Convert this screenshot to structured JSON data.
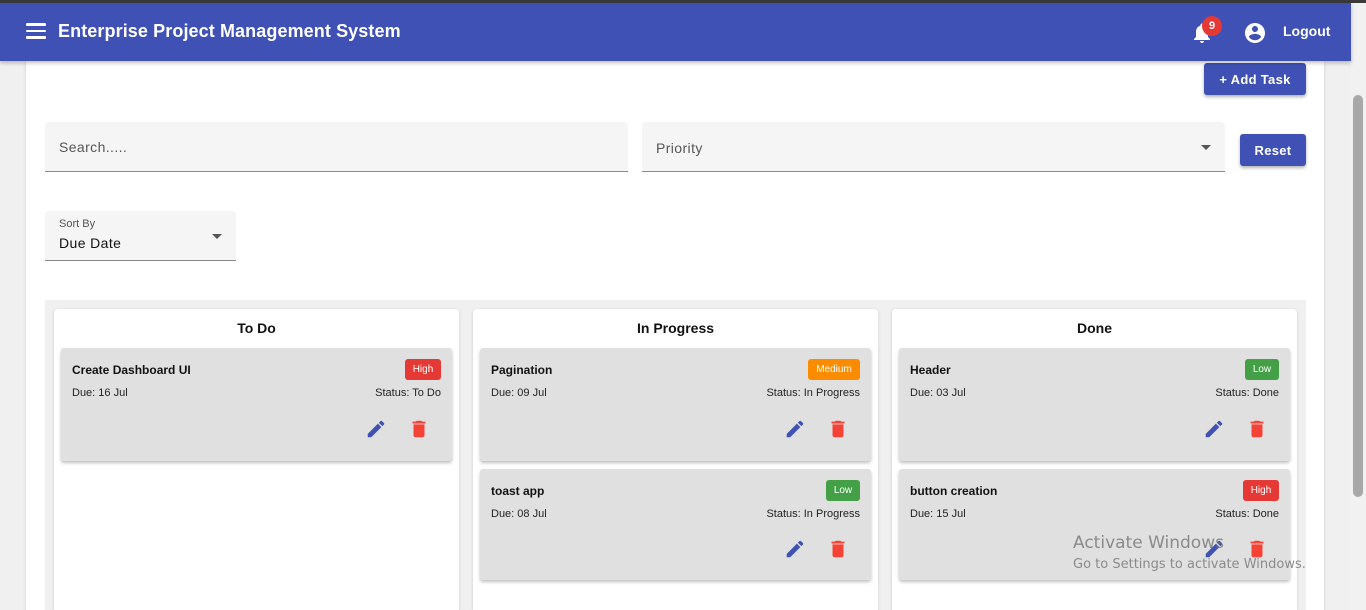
{
  "header": {
    "title": "Enterprise Project Management System",
    "notification_count": "9",
    "logout_label": "Logout"
  },
  "toolbar": {
    "add_task_label": "+ Add Task",
    "reset_label": "Reset"
  },
  "filters": {
    "search_placeholder": "Search.....",
    "priority_placeholder": "Priority",
    "sort_label": "Sort By",
    "sort_value": "Due Date"
  },
  "colors": {
    "primary": "#3f51b5",
    "high": "#e53935",
    "medium": "#fb8c00",
    "low": "#43a047",
    "delete": "#f44336"
  },
  "icons": [
    "menu-icon",
    "bell-icon",
    "account-circle-icon",
    "edit-icon",
    "delete-icon"
  ],
  "board": {
    "columns": [
      {
        "title": "To Do",
        "cards": [
          {
            "title": "Create Dashboard UI",
            "priority": "High",
            "due": "Due: 16 Jul",
            "status": "Status: To Do"
          }
        ]
      },
      {
        "title": "In Progress",
        "cards": [
          {
            "title": "Pagination",
            "priority": "Medium",
            "due": "Due: 09 Jul",
            "status": "Status: In Progress"
          },
          {
            "title": "toast app",
            "priority": "Low",
            "due": "Due: 08 Jul",
            "status": "Status: In Progress"
          }
        ]
      },
      {
        "title": "Done",
        "cards": [
          {
            "title": "Header",
            "priority": "Low",
            "due": "Due: 03 Jul",
            "status": "Status: Done"
          },
          {
            "title": "button creation",
            "priority": "High",
            "due": "Due: 15 Jul",
            "status": "Status: Done"
          }
        ]
      }
    ]
  },
  "watermark": {
    "line1": "Activate Windows",
    "line2": "Go to Settings to activate Windows."
  }
}
